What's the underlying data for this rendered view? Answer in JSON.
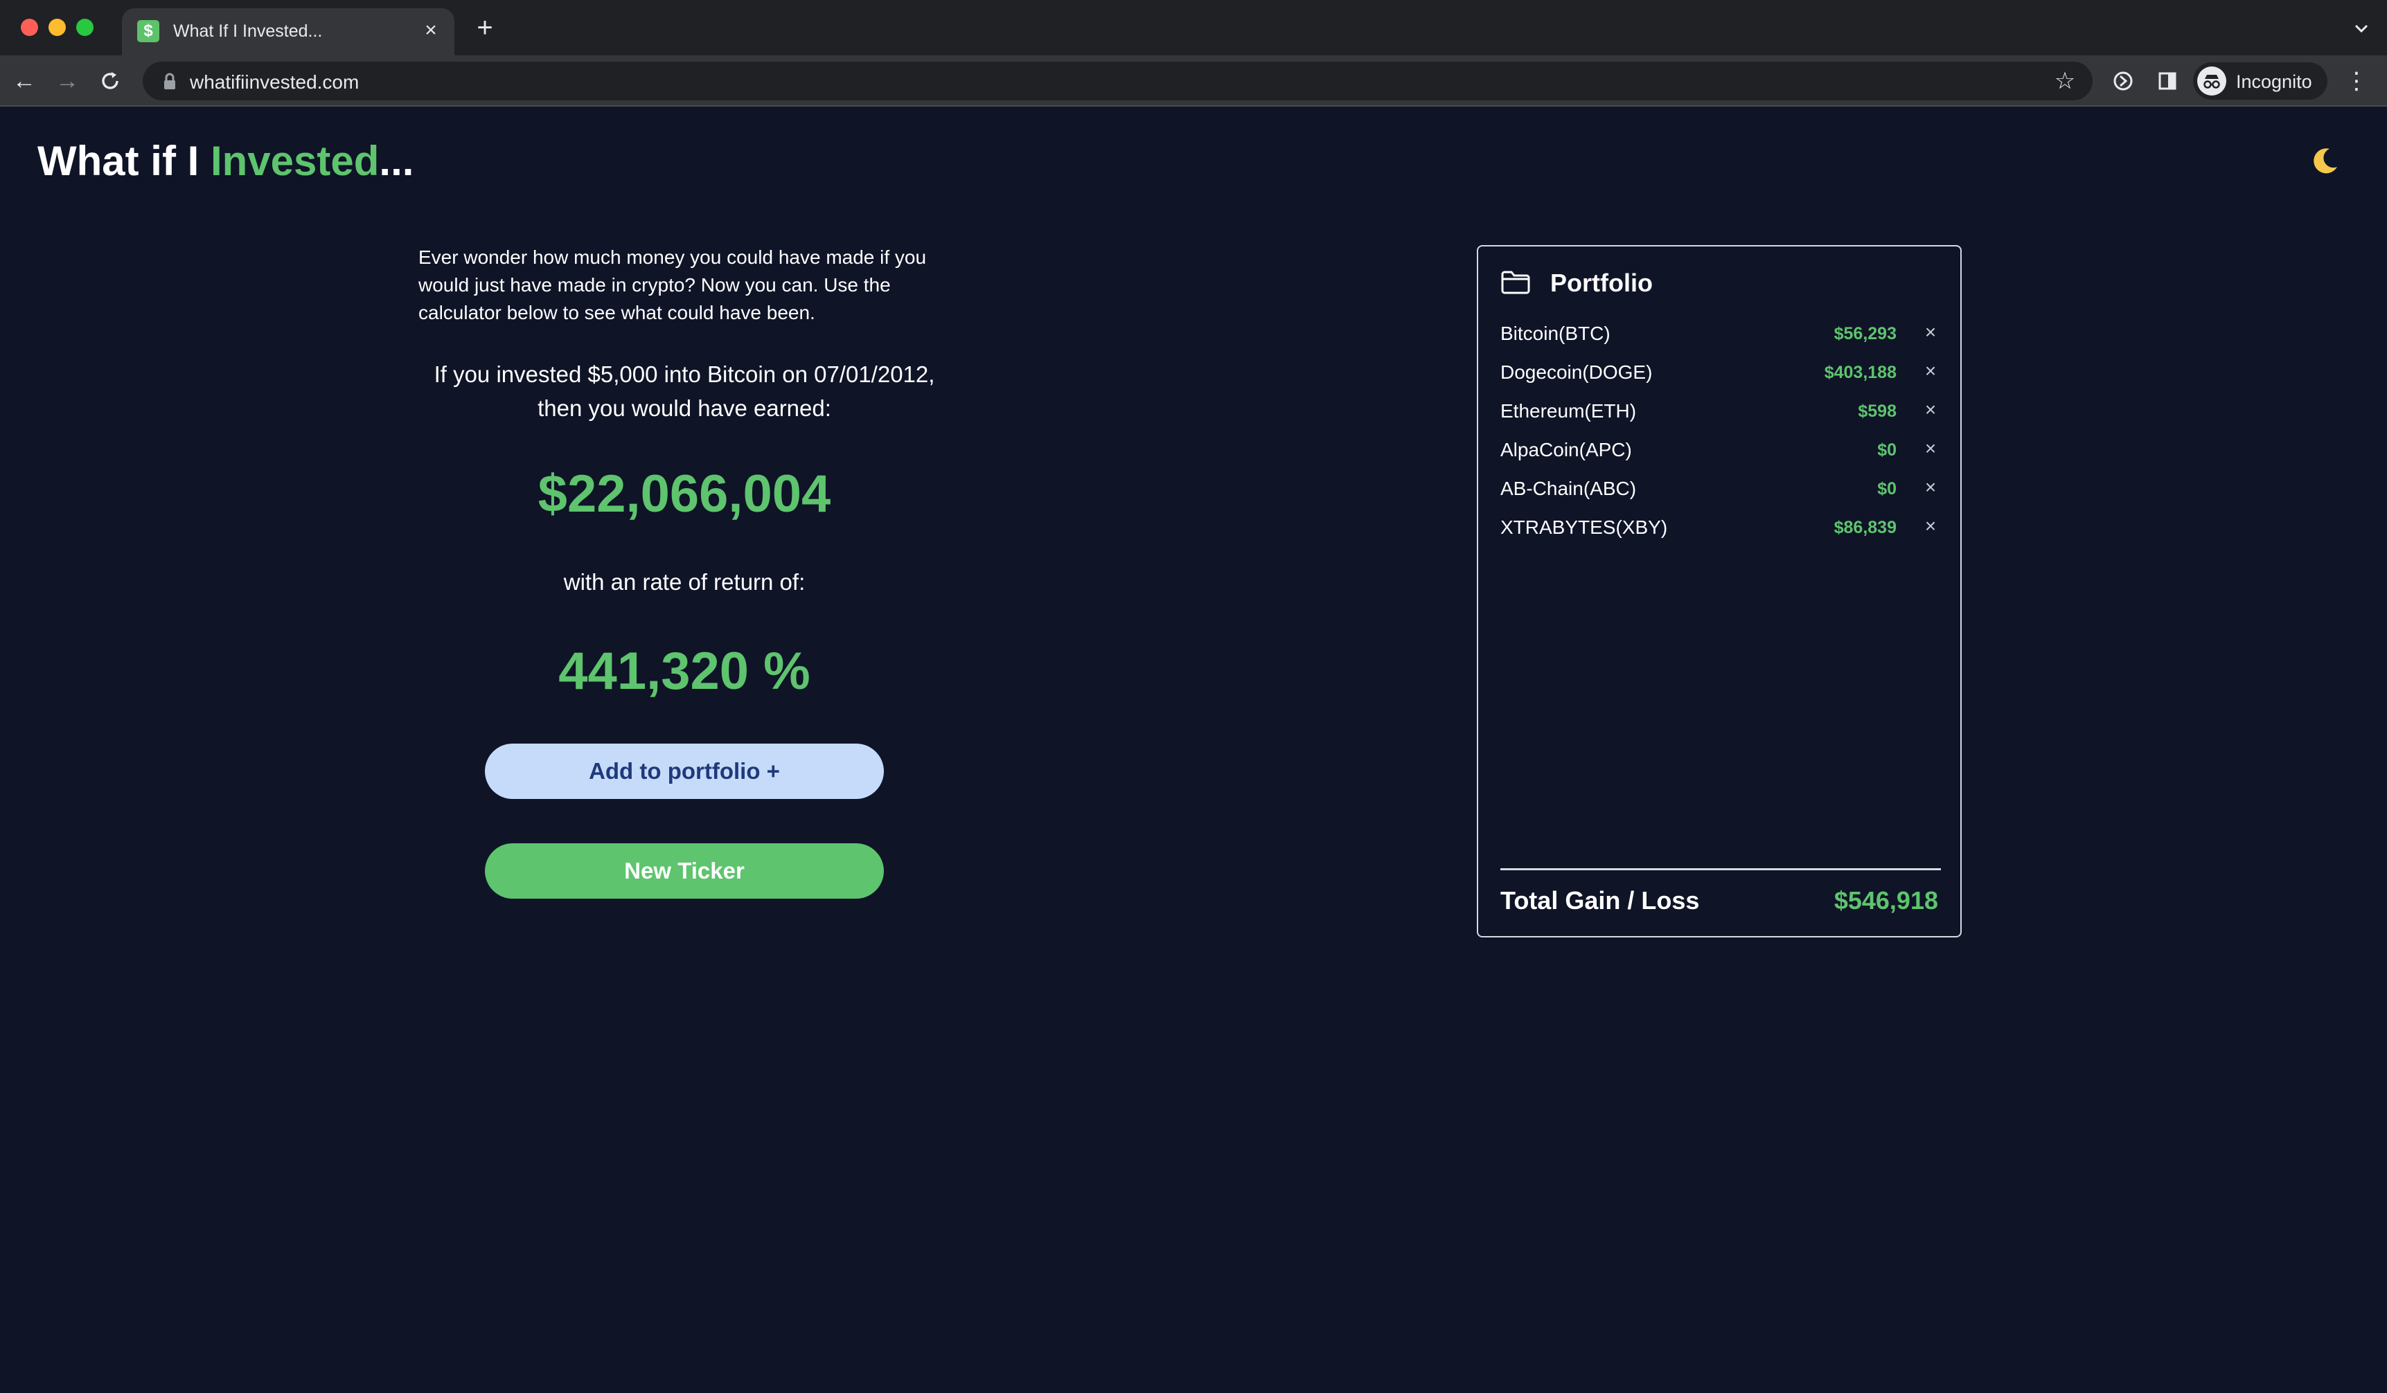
{
  "browser": {
    "tab_title": "What If I Invested...",
    "url": "whatifiinvested.com",
    "profile_label": "Incognito",
    "favicon_glyph": "$"
  },
  "header": {
    "title_prefix": "What if I ",
    "title_accent": "Invested",
    "title_suffix": "..."
  },
  "calculator": {
    "intro": "Ever wonder how much money you could have made if you would just have made in crypto? Now you can. Use the calculator below to see what could have been.",
    "sentence_line1": "If you invested $5,000 into Bitcoin on 07/01/2012,",
    "sentence_line2": "then you would have earned:",
    "earned": "$22,066,004",
    "rate_label": "with an rate of return of:",
    "rate_value": "441,320 %",
    "add_button": "Add to portfolio +",
    "new_button": "New Ticker"
  },
  "portfolio": {
    "title": "Portfolio",
    "items": [
      {
        "name": "Bitcoin(BTC)",
        "value": "$56,293"
      },
      {
        "name": "Dogecoin(DOGE)",
        "value": "$403,188"
      },
      {
        "name": "Ethereum(ETH)",
        "value": "$598"
      },
      {
        "name": "AlpaCoin(APC)",
        "value": "$0"
      },
      {
        "name": "AB-Chain(ABC)",
        "value": "$0"
      },
      {
        "name": "XTRABYTES(XBY)",
        "value": "$86,839"
      }
    ],
    "total_label": "Total Gain / Loss",
    "total_value": "$546,918"
  },
  "colors": {
    "background": "#0f1427",
    "accent_green": "#5ec46e",
    "button_light_blue": "#c6dbf9",
    "button_text_navy": "#1e3a7b",
    "moon_yellow": "#f5c84b"
  },
  "icons": {
    "theme_toggle": "moon-icon",
    "portfolio": "folder-icon",
    "remove": "close-icon"
  }
}
